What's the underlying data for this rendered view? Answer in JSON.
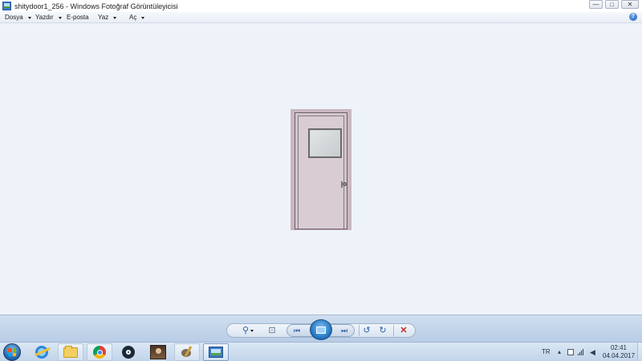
{
  "window": {
    "title": "shitydoor1_256 - Windows Fotoğraf Görüntüleyicisi",
    "controls": {
      "minimize": "—",
      "maximize": "□",
      "close": "✕"
    }
  },
  "menu": {
    "items": [
      {
        "label": "Dosya",
        "has_dropdown": true
      },
      {
        "label": "Yazdır",
        "has_dropdown": true
      },
      {
        "label": "E-posta",
        "has_dropdown": false
      },
      {
        "label": "Yaz",
        "has_dropdown": true
      },
      {
        "label": "Aç",
        "has_dropdown": true
      }
    ],
    "help": "?"
  },
  "viewer": {
    "image_subject": "door",
    "background_color": "#eef3fa"
  },
  "toolbar": {
    "zoom": "⚲",
    "fit": "⊡",
    "previous": "⏮",
    "slideshow": "slideshow-icon",
    "next": "⏭",
    "rotate_ccw": "↺",
    "rotate_cw": "↻",
    "delete": "✕"
  },
  "taskbar": {
    "apps": [
      {
        "name": "internet-explorer-icon"
      },
      {
        "name": "file-explorer-icon"
      },
      {
        "name": "chrome-icon"
      },
      {
        "name": "steam-icon"
      },
      {
        "name": "game-icon"
      },
      {
        "name": "gimp-icon"
      },
      {
        "name": "photo-viewer-icon"
      }
    ],
    "tray": {
      "language": "TR",
      "time": "02:41",
      "date": "04.04.2017"
    }
  },
  "colors": {
    "accent": "#2a5fa8",
    "delete": "#cc2a2a",
    "toolbar_bg": "#c4d6ec"
  }
}
